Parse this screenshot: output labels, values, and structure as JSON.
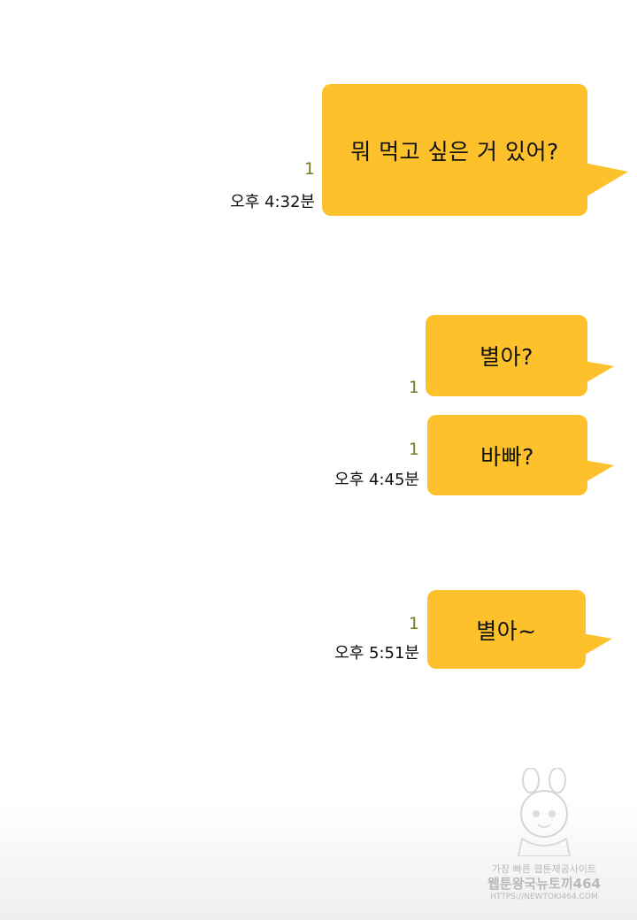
{
  "colors": {
    "bubble": "#fdc12c",
    "unread_count": "#7a7a2a",
    "text": "#111111"
  },
  "messages": [
    {
      "text": "뭐 먹고 싶은 거 있어?",
      "unread": "1",
      "time": "오후 4:32분"
    },
    {
      "text": "별아?",
      "unread": "1",
      "time": ""
    },
    {
      "text": "바빠?",
      "unread": "1",
      "time": "오후 4:45분"
    },
    {
      "text": "별아~",
      "unread": "1",
      "time": "오후 5:51분"
    }
  ],
  "watermark": {
    "line1": "가장 빠른 웹툰제공사이트",
    "line2": "웹툰왕국뉴토끼464",
    "line3": "HTTPS://NEWTOKI464.COM"
  }
}
